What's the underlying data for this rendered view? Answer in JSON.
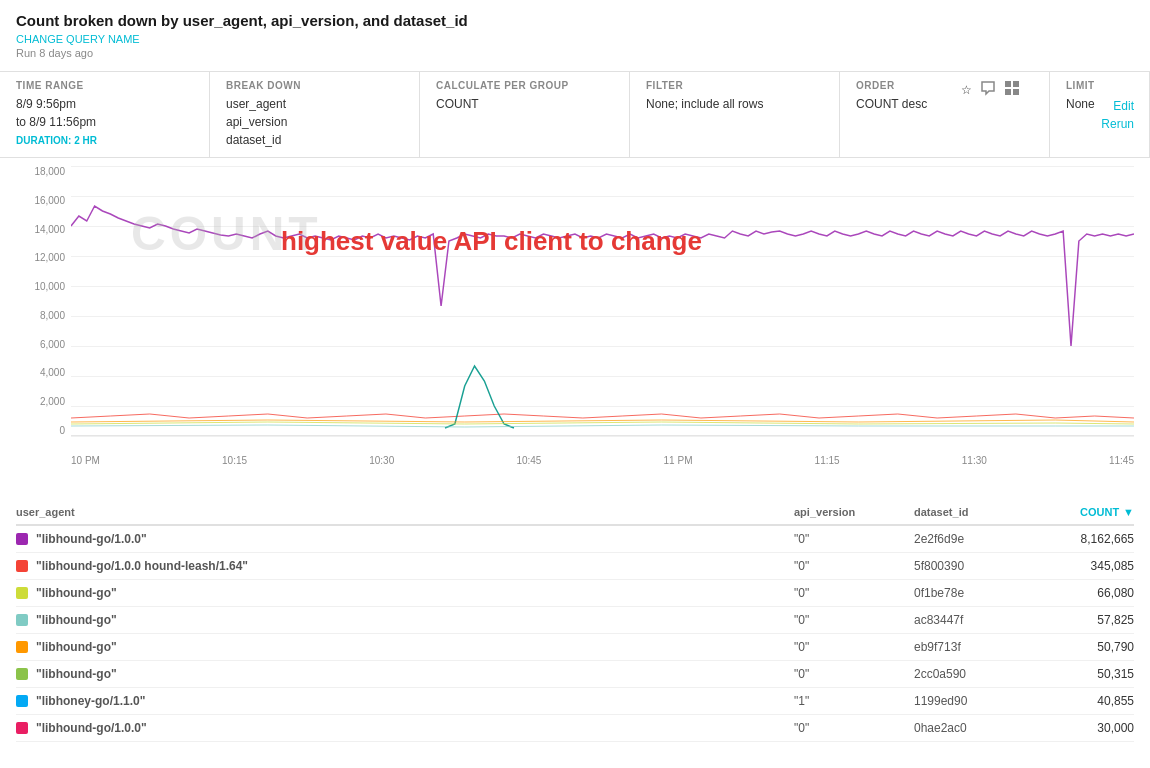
{
  "header": {
    "title": "Count broken down by user_agent, api_version, and dataset_id",
    "change_query_label": "CHANGE QUERY NAME",
    "run_info": "Run 8 days ago"
  },
  "toolbar": {
    "time_range": {
      "label": "TIME RANGE",
      "from": "8/9 9:56pm",
      "to": "to 8/9 11:56pm",
      "duration": "DURATION: 2 HR"
    },
    "break_down": {
      "label": "BREAK DOWN",
      "values": [
        "user_agent",
        "api_version",
        "dataset_id"
      ]
    },
    "calculate": {
      "label": "CALCULATE PER GROUP",
      "value": "COUNT"
    },
    "filter": {
      "label": "FILTER",
      "value": "None; include all rows"
    },
    "order": {
      "label": "ORDER",
      "value": "COUNT desc"
    },
    "limit": {
      "label": "LIMIT",
      "value": "None"
    },
    "edit_label": "Edit",
    "rerun_label": "Rerun"
  },
  "chart": {
    "watermark": "COUNT",
    "annotation": "highest value API client to change",
    "y_labels": [
      "18,000",
      "16,000",
      "14,000",
      "12,000",
      "10,000",
      "8,000",
      "6,000",
      "4,000",
      "2,000",
      "0"
    ],
    "x_labels": [
      "10 PM",
      "10:15",
      "10:30",
      "10:45",
      "11 PM",
      "11:15",
      "11:30",
      "11:45"
    ]
  },
  "table": {
    "columns": {
      "user_agent": "user_agent",
      "api_version": "api_version",
      "dataset_id": "dataset_id",
      "count": "COUNT"
    },
    "rows": [
      {
        "color": "#9c27b0",
        "user_agent": "\"libhound-go/1.0.0\"",
        "api_version": "\"0\"",
        "dataset_id": "2e2f6d9e",
        "count": "8,162,665"
      },
      {
        "color": "#f44336",
        "user_agent": "\"libhound-go/1.0.0 hound-leash/1.64\"",
        "api_version": "\"0\"",
        "dataset_id": "5f800390",
        "count": "345,085"
      },
      {
        "color": "#cddc39",
        "user_agent": "\"libhound-go\"",
        "api_version": "\"0\"",
        "dataset_id": "0f1be78e",
        "count": "66,080"
      },
      {
        "color": "#80cbc4",
        "user_agent": "\"libhound-go\"",
        "api_version": "\"0\"",
        "dataset_id": "ac83447f",
        "count": "57,825"
      },
      {
        "color": "#ff9800",
        "user_agent": "\"libhound-go\"",
        "api_version": "\"0\"",
        "dataset_id": "eb9f713f",
        "count": "50,790"
      },
      {
        "color": "#8bc34a",
        "user_agent": "\"libhound-go\"",
        "api_version": "\"0\"",
        "dataset_id": "2cc0a590",
        "count": "50,315"
      },
      {
        "color": "#03a9f4",
        "user_agent": "\"libhoney-go/1.1.0\"",
        "api_version": "\"1\"",
        "dataset_id": "1199ed90",
        "count": "40,855"
      },
      {
        "color": "#e91e63",
        "user_agent": "\"libhound-go/1.0.0\"",
        "api_version": "\"0\"",
        "dataset_id": "0hae2ac0",
        "count": "30,000"
      }
    ]
  },
  "icons": {
    "star": "☆",
    "comment": "💬",
    "grid": "▦",
    "sort_down": "▼"
  }
}
